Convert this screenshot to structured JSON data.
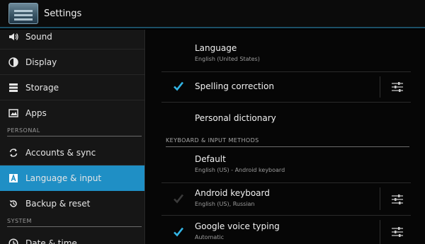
{
  "action_bar": {
    "title": "Settings"
  },
  "sidebar": {
    "items": [
      {
        "label": "Sound",
        "icon": "speaker-icon"
      },
      {
        "label": "Display",
        "icon": "brightness-icon"
      },
      {
        "label": "Storage",
        "icon": "storage-icon"
      },
      {
        "label": "Apps",
        "icon": "apps-icon"
      },
      {
        "label": "Accounts & sync",
        "icon": "sync-icon"
      },
      {
        "label": "Language & input",
        "icon": "language-icon"
      },
      {
        "label": "Backup & reset",
        "icon": "backup-icon"
      },
      {
        "label": "Date & time",
        "icon": "clock-icon"
      }
    ],
    "headers": {
      "personal": "PERSONAL",
      "system": "SYSTEM"
    },
    "active_index": 5
  },
  "content": {
    "language": {
      "title": "Language",
      "subtitle": "English (United States)"
    },
    "spelling": {
      "title": "Spelling correction",
      "checked": true
    },
    "dictionary": {
      "title": "Personal dictionary"
    },
    "keyboard_header": "KEYBOARD & INPUT METHODS",
    "default": {
      "title": "Default",
      "subtitle": "English (US) - Android keyboard"
    },
    "android_keyboard": {
      "title": "Android keyboard",
      "subtitle": "English (US), Russian",
      "checked": true,
      "disabled": true
    },
    "google_voice": {
      "title": "Google voice typing",
      "subtitle": "Automatic",
      "checked": true
    }
  },
  "colors": {
    "accent": "#1f8fc5",
    "check": "#33b5e5"
  }
}
